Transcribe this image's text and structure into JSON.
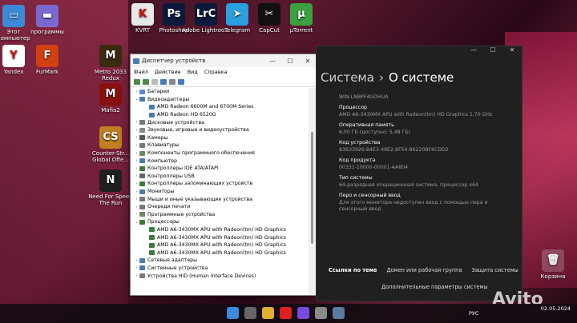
{
  "desktop": {
    "icons_left": [
      {
        "label": "Этот компьютер",
        "color": "#3a8ad8",
        "glyph": "▭"
      },
      {
        "label": "программы",
        "color": "#7a6ad0",
        "glyph": "▬"
      },
      {
        "label": "Yandex",
        "color": "#ffffff",
        "glyph": "Y"
      },
      {
        "label": "FurMark",
        "color": "#d04010",
        "glyph": "F"
      }
    ],
    "icons_top": [
      {
        "label": "KVRT",
        "color": "#e8e8e8",
        "glyph": "K"
      },
      {
        "label": "Photoshop",
        "color": "#0a1a3a",
        "glyph": "Ps"
      },
      {
        "label": "Adobe Lightroo...",
        "color": "#0a1a3a",
        "glyph": "LrC"
      },
      {
        "label": "Telegram",
        "color": "#2aa0e0",
        "glyph": "➤"
      },
      {
        "label": "CapCut",
        "color": "#111111",
        "glyph": "✂"
      },
      {
        "label": "µTorrent",
        "color": "#3aa040",
        "glyph": "µ"
      }
    ],
    "icons_col2": [
      {
        "label": "Metro 2033 Redux",
        "color": "#3a2a10",
        "glyph": "M"
      },
      {
        "label": "Mafia2",
        "color": "#8a1010",
        "glyph": "M"
      },
      {
        "label": "Counter-Str... Global Offe...",
        "color": "#c08020",
        "glyph": "CS"
      },
      {
        "label": "Need For Speed The Run",
        "color": "#202020",
        "glyph": "N"
      }
    ],
    "recycle_bin": "Корзина"
  },
  "device_manager": {
    "title": "Диспетчер устройств",
    "menu": [
      "Файл",
      "Действие",
      "Вид",
      "Справка"
    ],
    "tree": [
      {
        "text": "Батареи",
        "indent": 0,
        "ex": "›",
        "color": "#5a8ad0"
      },
      {
        "text": "Видеоадаптеры",
        "indent": 0,
        "ex": "⌄",
        "color": "#4a7ab0"
      },
      {
        "text": "AMD Radeon 6600M and 6700M Series",
        "indent": 1,
        "ex": "",
        "color": "#4a7ab0"
      },
      {
        "text": "AMD Radeon HD 6520G",
        "indent": 1,
        "ex": "",
        "color": "#4a7ab0"
      },
      {
        "text": "Дисковые устройства",
        "indent": 0,
        "ex": "›",
        "color": "#777777"
      },
      {
        "text": "Звуковые, игровые и видеоустройства",
        "indent": 0,
        "ex": "›",
        "color": "#888888"
      },
      {
        "text": "Камеры",
        "indent": 0,
        "ex": "›",
        "color": "#555555"
      },
      {
        "text": "Клавиатуры",
        "indent": 0,
        "ex": "›",
        "color": "#777777"
      },
      {
        "text": "Компоненты программного обеспечения",
        "indent": 0,
        "ex": "›",
        "color": "#6a8a5a"
      },
      {
        "text": "Компьютер",
        "indent": 0,
        "ex": "›",
        "color": "#4a7ab0"
      },
      {
        "text": "Контроллеры IDE ATA/ATAPI",
        "indent": 0,
        "ex": "›",
        "color": "#3a7a3a"
      },
      {
        "text": "Контроллеры USB",
        "indent": 0,
        "ex": "›",
        "color": "#666666"
      },
      {
        "text": "Контроллеры запоминающих устройств",
        "indent": 0,
        "ex": "›",
        "color": "#3a7a3a"
      },
      {
        "text": "Мониторы",
        "indent": 0,
        "ex": "›",
        "color": "#4a7ab0"
      },
      {
        "text": "Мыши и иные указывающие устройства",
        "indent": 0,
        "ex": "›",
        "color": "#777777"
      },
      {
        "text": "Очереди печати",
        "indent": 0,
        "ex": "›",
        "color": "#777777"
      },
      {
        "text": "Программные устройства",
        "indent": 0,
        "ex": "›",
        "color": "#6a8a5a"
      },
      {
        "text": "Процессоры",
        "indent": 0,
        "ex": "⌄",
        "color": "#3a7a3a"
      },
      {
        "text": "AMD A6-3430MX APU with Radeon(tm) HD Graphics",
        "indent": 1,
        "ex": "",
        "color": "#3a7a3a"
      },
      {
        "text": "AMD A6-3430MX APU with Radeon(tm) HD Graphics",
        "indent": 1,
        "ex": "",
        "color": "#3a7a3a"
      },
      {
        "text": "AMD A6-3430MX APU with Radeon(tm) HD Graphics",
        "indent": 1,
        "ex": "",
        "color": "#3a7a3a"
      },
      {
        "text": "AMD A6-3430MX APU with Radeon(tm) HD Graphics",
        "indent": 1,
        "ex": "",
        "color": "#3a7a3a"
      },
      {
        "text": "Сетевые адаптеры",
        "indent": 0,
        "ex": "›",
        "color": "#4a7ab0"
      },
      {
        "text": "Системные устройства",
        "indent": 0,
        "ex": "›",
        "color": "#4a7ab0"
      },
      {
        "text": "Устройства HID (Human Interface Devices)",
        "indent": 0,
        "ex": "›",
        "color": "#777777"
      }
    ]
  },
  "settings": {
    "breadcrumb_parent": "Система",
    "breadcrumb_sep": "›",
    "breadcrumb_current": "О системе",
    "device_name": "WIN-LNBPF4GOHUA",
    "specs": [
      {
        "label": "Процессор",
        "value": "AMD A6-3430MX APU with Radeon(tm) HD Graphics 1.70 GHz"
      },
      {
        "label": "Оперативная память",
        "value": "6,00 ГБ (доступно: 5,48 ГБ)"
      },
      {
        "label": "Код устройства",
        "value": "83B33926-B4E3-49E2-8F54-86220BF6CDD2"
      },
      {
        "label": "Код продукта",
        "value": "00331-10000-00001-AA804"
      },
      {
        "label": "Тип системы",
        "value": "64-разрядная операционная система, процессор x64"
      },
      {
        "label": "Перо и сенсорный ввод",
        "value": "Для этого монитора недоступен ввод с помощью пера и сенсорный ввод"
      }
    ],
    "links_label": "Ссылки по теме",
    "link_domain": "Домен или рабочая группа",
    "link_protection": "Защита системы",
    "link_advanced": "Дополнительные параметры системы"
  },
  "taskbar": {
    "apps": [
      {
        "name": "start",
        "color": "#3a8ae0"
      },
      {
        "name": "search",
        "color": "#666666"
      },
      {
        "name": "explorer",
        "color": "#e0b030"
      },
      {
        "name": "yandex",
        "color": "#e02020"
      },
      {
        "name": "alice",
        "color": "#7a4ae0"
      },
      {
        "name": "settings",
        "color": "#8a8a8a"
      },
      {
        "name": "device-manager",
        "color": "#5a7aa0"
      }
    ],
    "lang": "РУС",
    "date": "02.05.2024"
  },
  "watermark": "Avito"
}
